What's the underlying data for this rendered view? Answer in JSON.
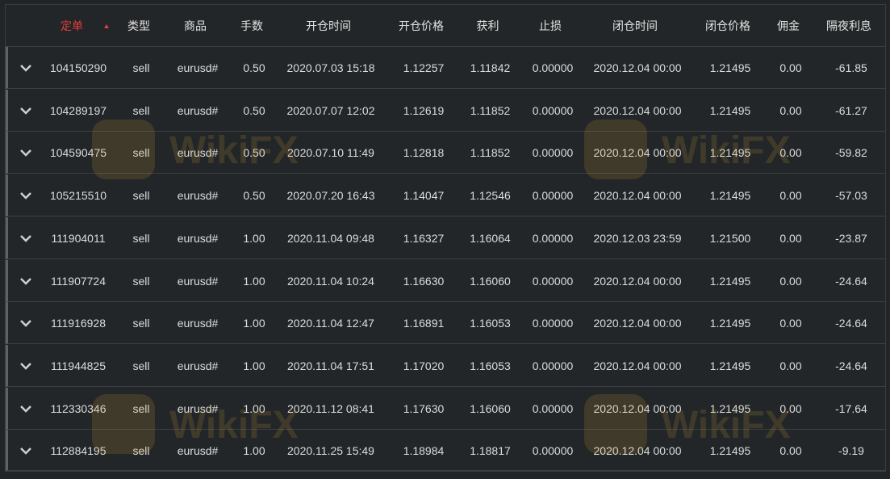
{
  "header": {
    "order": "定单",
    "type": "类型",
    "symbol": "商品",
    "lots": "手数",
    "open_time": "开仓时间",
    "open_price": "开仓价格",
    "profit": "获利",
    "stop_loss": "止损",
    "close_time": "闭仓时间",
    "close_price": "闭仓价格",
    "commission": "佣金",
    "swap": "隔夜利息"
  },
  "rows": [
    {
      "order": "104150290",
      "type": "sell",
      "symbol": "eurusd#",
      "lots": "0.50",
      "open_time": "2020.07.03 15:18",
      "open_price": "1.12257",
      "profit": "1.11842",
      "stop_loss": "0.00000",
      "close_time": "2020.12.04 00:00",
      "close_price": "1.21495",
      "commission": "0.00",
      "swap": "-61.85"
    },
    {
      "order": "104289197",
      "type": "sell",
      "symbol": "eurusd#",
      "lots": "0.50",
      "open_time": "2020.07.07 12:02",
      "open_price": "1.12619",
      "profit": "1.11852",
      "stop_loss": "0.00000",
      "close_time": "2020.12.04 00:00",
      "close_price": "1.21495",
      "commission": "0.00",
      "swap": "-61.27"
    },
    {
      "order": "104590475",
      "type": "sell",
      "symbol": "eurusd#",
      "lots": "0.50",
      "open_time": "2020.07.10 11:49",
      "open_price": "1.12818",
      "profit": "1.11852",
      "stop_loss": "0.00000",
      "close_time": "2020.12.04 00:00",
      "close_price": "1.21495",
      "commission": "0.00",
      "swap": "-59.82"
    },
    {
      "order": "105215510",
      "type": "sell",
      "symbol": "eurusd#",
      "lots": "0.50",
      "open_time": "2020.07.20 16:43",
      "open_price": "1.14047",
      "profit": "1.12546",
      "stop_loss": "0.00000",
      "close_time": "2020.12.04 00:00",
      "close_price": "1.21495",
      "commission": "0.00",
      "swap": "-57.03"
    },
    {
      "order": "111904011",
      "type": "sell",
      "symbol": "eurusd#",
      "lots": "1.00",
      "open_time": "2020.11.04 09:48",
      "open_price": "1.16327",
      "profit": "1.16064",
      "stop_loss": "0.00000",
      "close_time": "2020.12.03 23:59",
      "close_price": "1.21500",
      "commission": "0.00",
      "swap": "-23.87"
    },
    {
      "order": "111907724",
      "type": "sell",
      "symbol": "eurusd#",
      "lots": "1.00",
      "open_time": "2020.11.04 10:24",
      "open_price": "1.16630",
      "profit": "1.16060",
      "stop_loss": "0.00000",
      "close_time": "2020.12.04 00:00",
      "close_price": "1.21495",
      "commission": "0.00",
      "swap": "-24.64"
    },
    {
      "order": "111916928",
      "type": "sell",
      "symbol": "eurusd#",
      "lots": "1.00",
      "open_time": "2020.11.04 12:47",
      "open_price": "1.16891",
      "profit": "1.16053",
      "stop_loss": "0.00000",
      "close_time": "2020.12.04 00:00",
      "close_price": "1.21495",
      "commission": "0.00",
      "swap": "-24.64"
    },
    {
      "order": "111944825",
      "type": "sell",
      "symbol": "eurusd#",
      "lots": "1.00",
      "open_time": "2020.11.04 17:51",
      "open_price": "1.17020",
      "profit": "1.16053",
      "stop_loss": "0.00000",
      "close_time": "2020.12.04 00:00",
      "close_price": "1.21495",
      "commission": "0.00",
      "swap": "-24.64"
    },
    {
      "order": "112330346",
      "type": "sell",
      "symbol": "eurusd#",
      "lots": "1.00",
      "open_time": "2020.11.12 08:41",
      "open_price": "1.17630",
      "profit": "1.16060",
      "stop_loss": "0.00000",
      "close_time": "2020.12.04 00:00",
      "close_price": "1.21495",
      "commission": "0.00",
      "swap": "-17.64"
    },
    {
      "order": "112884195",
      "type": "sell",
      "symbol": "eurusd#",
      "lots": "1.00",
      "open_time": "2020.11.25 15:49",
      "open_price": "1.18984",
      "profit": "1.18817",
      "stop_loss": "0.00000",
      "close_time": "2020.12.04 00:00",
      "close_price": "1.21495",
      "commission": "0.00",
      "swap": "-9.19"
    }
  ],
  "watermark": {
    "text": "WikiFX"
  },
  "icons": {
    "expand": "chevron-down-icon",
    "sort": "sort-asc-icon"
  },
  "colors": {
    "active_header": "#e23c3c",
    "background": "#222527",
    "text": "#dcdcdc"
  }
}
